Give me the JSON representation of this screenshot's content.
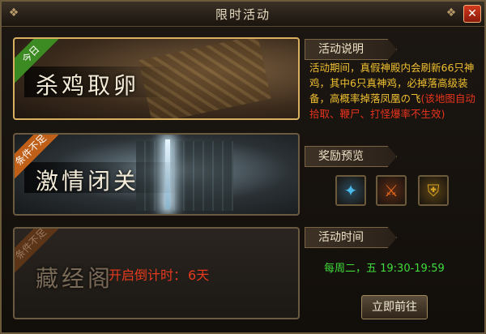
{
  "window": {
    "title": "限时活动",
    "close_label": "✕"
  },
  "activities": [
    {
      "name": "杀鸡取卵",
      "ribbon": "今日",
      "ribbon_color": "#3c8a22",
      "selected": true
    },
    {
      "name": "激情闭关",
      "ribbon": "条件不足",
      "ribbon_color": "#c06018",
      "selected": false
    },
    {
      "name": "藏经阁",
      "ribbon": "条件不足",
      "ribbon_color": "#5c3418",
      "selected": false,
      "countdown_label": "开启倒计时：",
      "countdown_value": "6天"
    }
  ],
  "info": {
    "desc_header": "活动说明",
    "desc_main": "活动期间，真假神殿内会刷新66只神鸡，其中6只真神鸡，必掉落高级装备，高概率掉落凤凰の飞",
    "desc_note": "(该地图自动拾取、鞭尸、打怪爆率不生效)",
    "reward_header": "奖励预览",
    "rewards": [
      {
        "icon": "gem-shard-icon",
        "color": "#4ab8e8"
      },
      {
        "icon": "sword-icon",
        "color": "#e86a1c"
      },
      {
        "icon": "armor-icon",
        "color": "#d8a020"
      }
    ],
    "time_header": "活动时间",
    "time_value": "每周二，五 19:30-19:59",
    "go_button": "立即前往"
  }
}
